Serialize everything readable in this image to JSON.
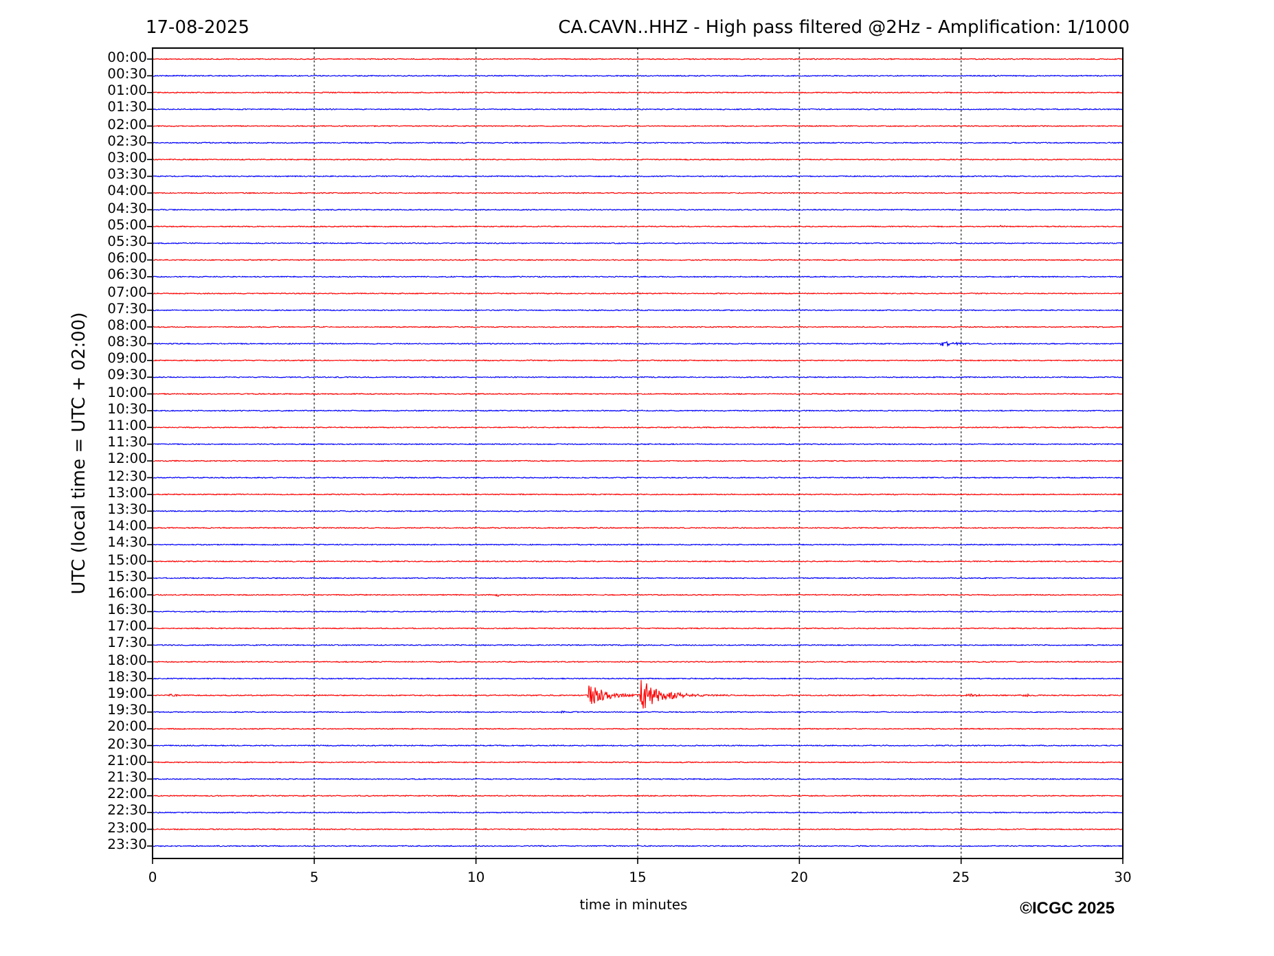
{
  "header": {
    "date": "17-08-2025",
    "title": "CA.CAVN..HHZ - High pass filtered @2Hz - Amplification: 1/1000"
  },
  "y_axis": {
    "label": "UTC (local time = UTC + 02:00)"
  },
  "traces": [
    {
      "label": "00:00",
      "color": "#ff0000"
    },
    {
      "label": "00:30",
      "color": "#0000ff"
    },
    {
      "label": "01:00",
      "color": "#ff0000"
    },
    {
      "label": "01:30",
      "color": "#0000ff"
    },
    {
      "label": "02:00",
      "color": "#ff0000"
    },
    {
      "label": "02:30",
      "color": "#0000ff"
    },
    {
      "label": "03:00",
      "color": "#ff0000"
    },
    {
      "label": "03:30",
      "color": "#0000ff"
    },
    {
      "label": "04:00",
      "color": "#ff0000"
    },
    {
      "label": "04:30",
      "color": "#0000ff"
    },
    {
      "label": "05:00",
      "color": "#ff0000"
    },
    {
      "label": "05:30",
      "color": "#0000ff"
    },
    {
      "label": "06:00",
      "color": "#ff0000"
    },
    {
      "label": "06:30",
      "color": "#0000ff"
    },
    {
      "label": "07:00",
      "color": "#ff0000"
    },
    {
      "label": "07:30",
      "color": "#0000ff"
    },
    {
      "label": "08:00",
      "color": "#ff0000"
    },
    {
      "label": "08:30",
      "color": "#0000ff"
    },
    {
      "label": "09:00",
      "color": "#ff0000"
    },
    {
      "label": "09:30",
      "color": "#0000ff"
    },
    {
      "label": "10:00",
      "color": "#ff0000"
    },
    {
      "label": "10:30",
      "color": "#0000ff"
    },
    {
      "label": "11:00",
      "color": "#ff0000"
    },
    {
      "label": "11:30",
      "color": "#0000ff"
    },
    {
      "label": "12:00",
      "color": "#ff0000"
    },
    {
      "label": "12:30",
      "color": "#0000ff"
    },
    {
      "label": "13:00",
      "color": "#ff0000"
    },
    {
      "label": "13:30",
      "color": "#0000ff"
    },
    {
      "label": "14:00",
      "color": "#ff0000"
    },
    {
      "label": "14:30",
      "color": "#0000ff"
    },
    {
      "label": "15:00",
      "color": "#ff0000"
    },
    {
      "label": "15:30",
      "color": "#0000ff"
    },
    {
      "label": "16:00",
      "color": "#ff0000"
    },
    {
      "label": "16:30",
      "color": "#0000ff"
    },
    {
      "label": "17:00",
      "color": "#ff0000"
    },
    {
      "label": "17:30",
      "color": "#0000ff"
    },
    {
      "label": "18:00",
      "color": "#ff0000"
    },
    {
      "label": "18:30",
      "color": "#0000ff"
    },
    {
      "label": "19:00",
      "color": "#ff0000"
    },
    {
      "label": "19:30",
      "color": "#0000ff"
    },
    {
      "label": "20:00",
      "color": "#ff0000"
    },
    {
      "label": "20:30",
      "color": "#0000ff"
    },
    {
      "label": "21:00",
      "color": "#ff0000"
    },
    {
      "label": "21:30",
      "color": "#0000ff"
    },
    {
      "label": "22:00",
      "color": "#ff0000"
    },
    {
      "label": "22:30",
      "color": "#0000ff"
    },
    {
      "label": "23:00",
      "color": "#ff0000"
    },
    {
      "label": "23:30",
      "color": "#0000ff"
    }
  ],
  "x_axis": {
    "label": "time in minutes",
    "ticks": [
      "0",
      "5",
      "10",
      "15",
      "20",
      "25",
      "30"
    ]
  },
  "copyright": "©ICGC 2025"
}
